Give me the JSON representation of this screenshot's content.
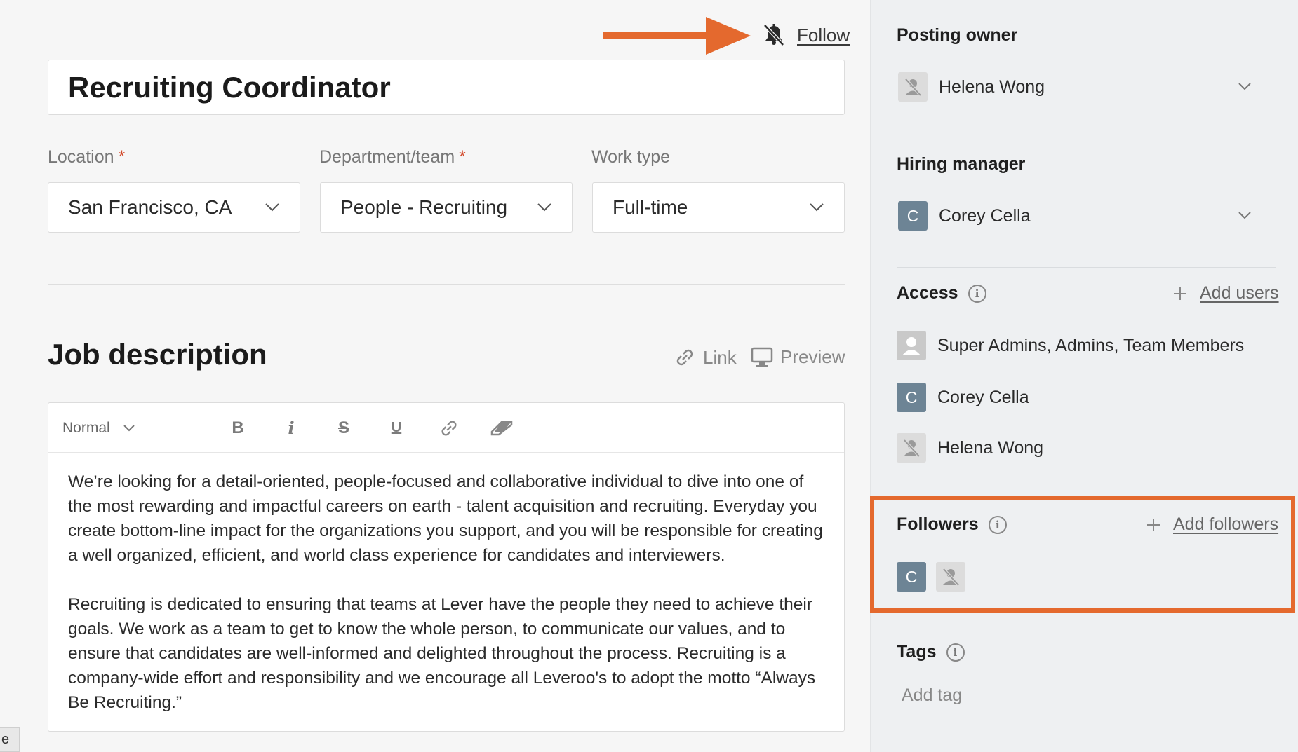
{
  "header": {
    "follow_label": "Follow",
    "job_title": "Recruiting Coordinator"
  },
  "fields": {
    "location": {
      "label": "Location",
      "required": "*",
      "value": "San Francisco, CA"
    },
    "department": {
      "label": "Department/team",
      "required": "*",
      "value": "People - Recruiting"
    },
    "work_type": {
      "label": "Work type",
      "value": "Full-time"
    }
  },
  "job_description": {
    "title": "Job description",
    "link_label": "Link",
    "preview_label": "Preview",
    "toolbar": {
      "style_value": "Normal",
      "bold": "B",
      "italic": "i",
      "strike": "S",
      "underline": "U"
    },
    "paragraphs": [
      "We’re looking for a detail-oriented, people-focused and collaborative individual to dive into one of the most rewarding and impactful careers on earth - talent acquisition and recruiting. Everyday you create bottom-line impact for the organizations you support, and you will be responsible for creating a well organized, efficient, and world class experience for candidates and interviewers.",
      "Recruiting is dedicated to ensuring that teams at Lever have the people they need to achieve their goals. We work as a team to get to know the whole person, to communicate our values, and to ensure that candidates are well-informed and delighted throughout the process. Recruiting is a company-wide effort and responsibility and we encourage all Leveroo's to adopt the motto “Always Be Recruiting.”"
    ]
  },
  "side_tab_text": "e",
  "sidebar": {
    "posting_owner": {
      "label": "Posting owner",
      "name": "Helena Wong"
    },
    "hiring_manager": {
      "label": "Hiring manager",
      "name": "Corey Cella",
      "initial": "C"
    },
    "access": {
      "label": "Access",
      "info": "i",
      "add_label": "Add users",
      "entries": [
        {
          "name": "Super Admins, Admins, Team Members",
          "type": "group"
        },
        {
          "name": "Corey Cella",
          "type": "initial",
          "initial": "C"
        },
        {
          "name": "Helena Wong",
          "type": "ghost"
        }
      ]
    },
    "followers": {
      "label": "Followers",
      "info": "i",
      "add_label": "Add followers",
      "avatars": [
        {
          "type": "initial",
          "initial": "C"
        },
        {
          "type": "ghost"
        }
      ]
    },
    "tags": {
      "label": "Tags",
      "info": "i",
      "placeholder": "Add tag"
    }
  },
  "colors": {
    "accent_orange": "#e4692e",
    "avatar_blue": "#6d8495",
    "required_red": "#d2492a"
  }
}
